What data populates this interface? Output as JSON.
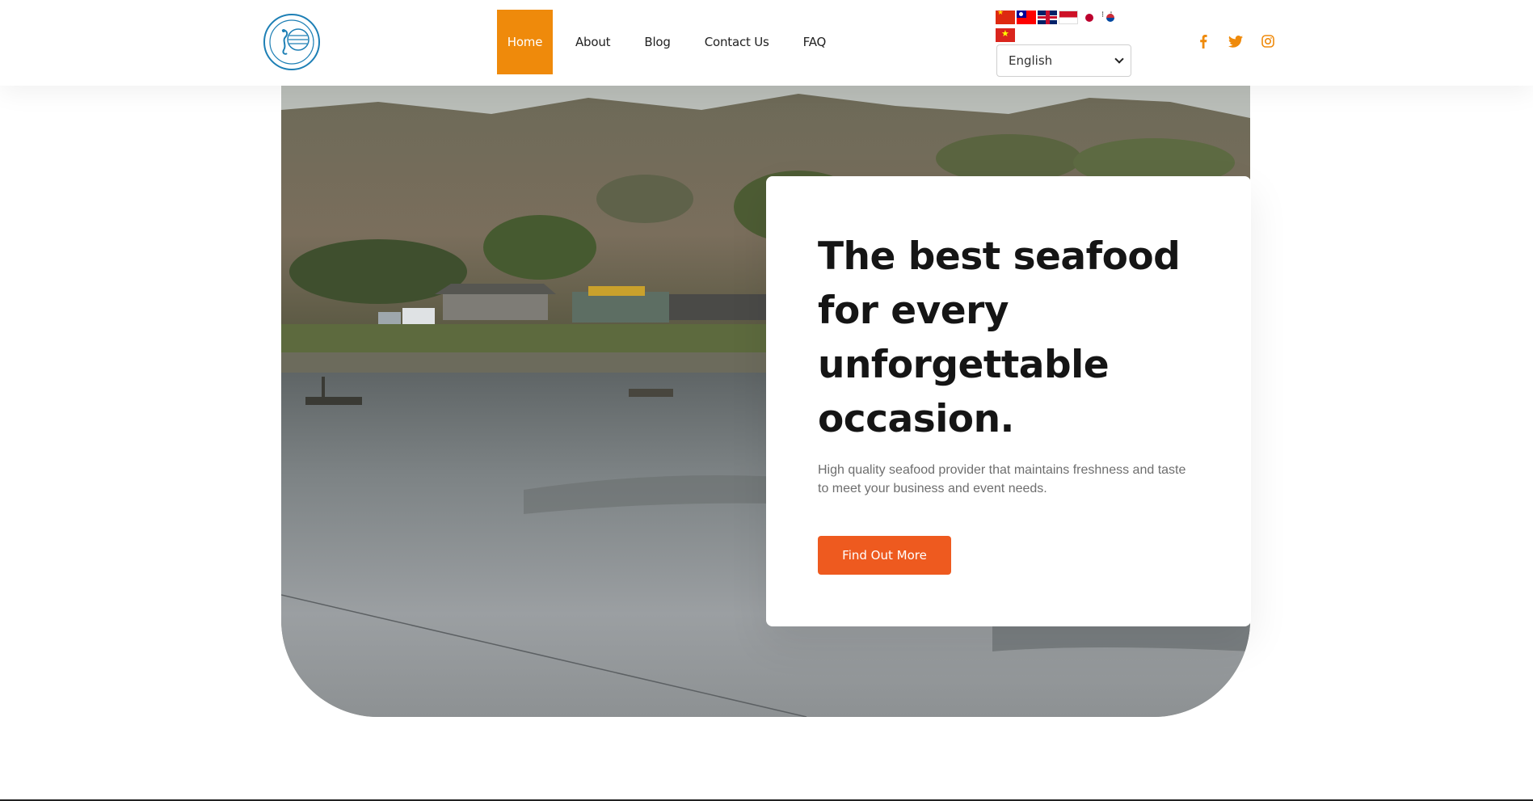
{
  "header": {
    "nav": [
      {
        "label": "Home",
        "active": true
      },
      {
        "label": "About",
        "active": false
      },
      {
        "label": "Blog",
        "active": false
      },
      {
        "label": "Contact Us",
        "active": false
      },
      {
        "label": "FAQ",
        "active": false
      }
    ],
    "flags": [
      "chinese-simplified-flag",
      "chinese-traditional-flag",
      "uk-flag",
      "indonesia-flag",
      "japan-flag",
      "korea-flag",
      "vietnam-flag"
    ],
    "language_select": {
      "selected": "English"
    },
    "socials": [
      "facebook-icon",
      "twitter-icon",
      "instagram-icon"
    ],
    "accent_color": "#ef8a0b"
  },
  "hero": {
    "title": "The best seafood for every unforgettable occasion.",
    "text": "High quality seafood provider that maintains freshness and taste to meet your business and event needs.",
    "cta_label": "Find Out More",
    "cta_color": "#ee5a1f"
  }
}
